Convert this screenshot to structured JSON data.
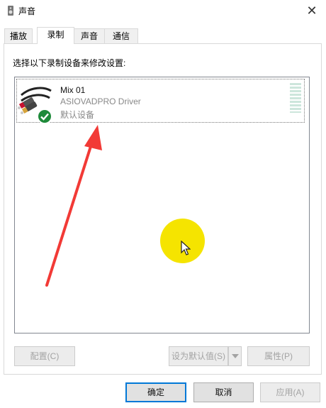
{
  "window": {
    "title": "声音",
    "close_glyph": "✕"
  },
  "tabs": [
    {
      "label": "播放",
      "active": false
    },
    {
      "label": "录制",
      "active": true
    },
    {
      "label": "声音",
      "active": false
    },
    {
      "label": "通信",
      "active": false
    }
  ],
  "instruction": "选择以下录制设备来修改设置:",
  "device": {
    "name": "Mix 01",
    "driver": "ASIOVADPRO Driver",
    "status": "默认设备",
    "icon": "rca-cable-icon",
    "status_icon": "default-checkmark-icon"
  },
  "buttons": {
    "configure": "配置(C)",
    "set_default": "设为默认值(S)",
    "properties": "属性(P)",
    "ok": "确定",
    "cancel": "取消",
    "apply": "应用(A)"
  },
  "colors": {
    "annotation_arrow": "#f23a36",
    "cursor_highlight": "#f5e400",
    "default_check": "#1e8a3a",
    "focus_border": "#0078d7"
  }
}
